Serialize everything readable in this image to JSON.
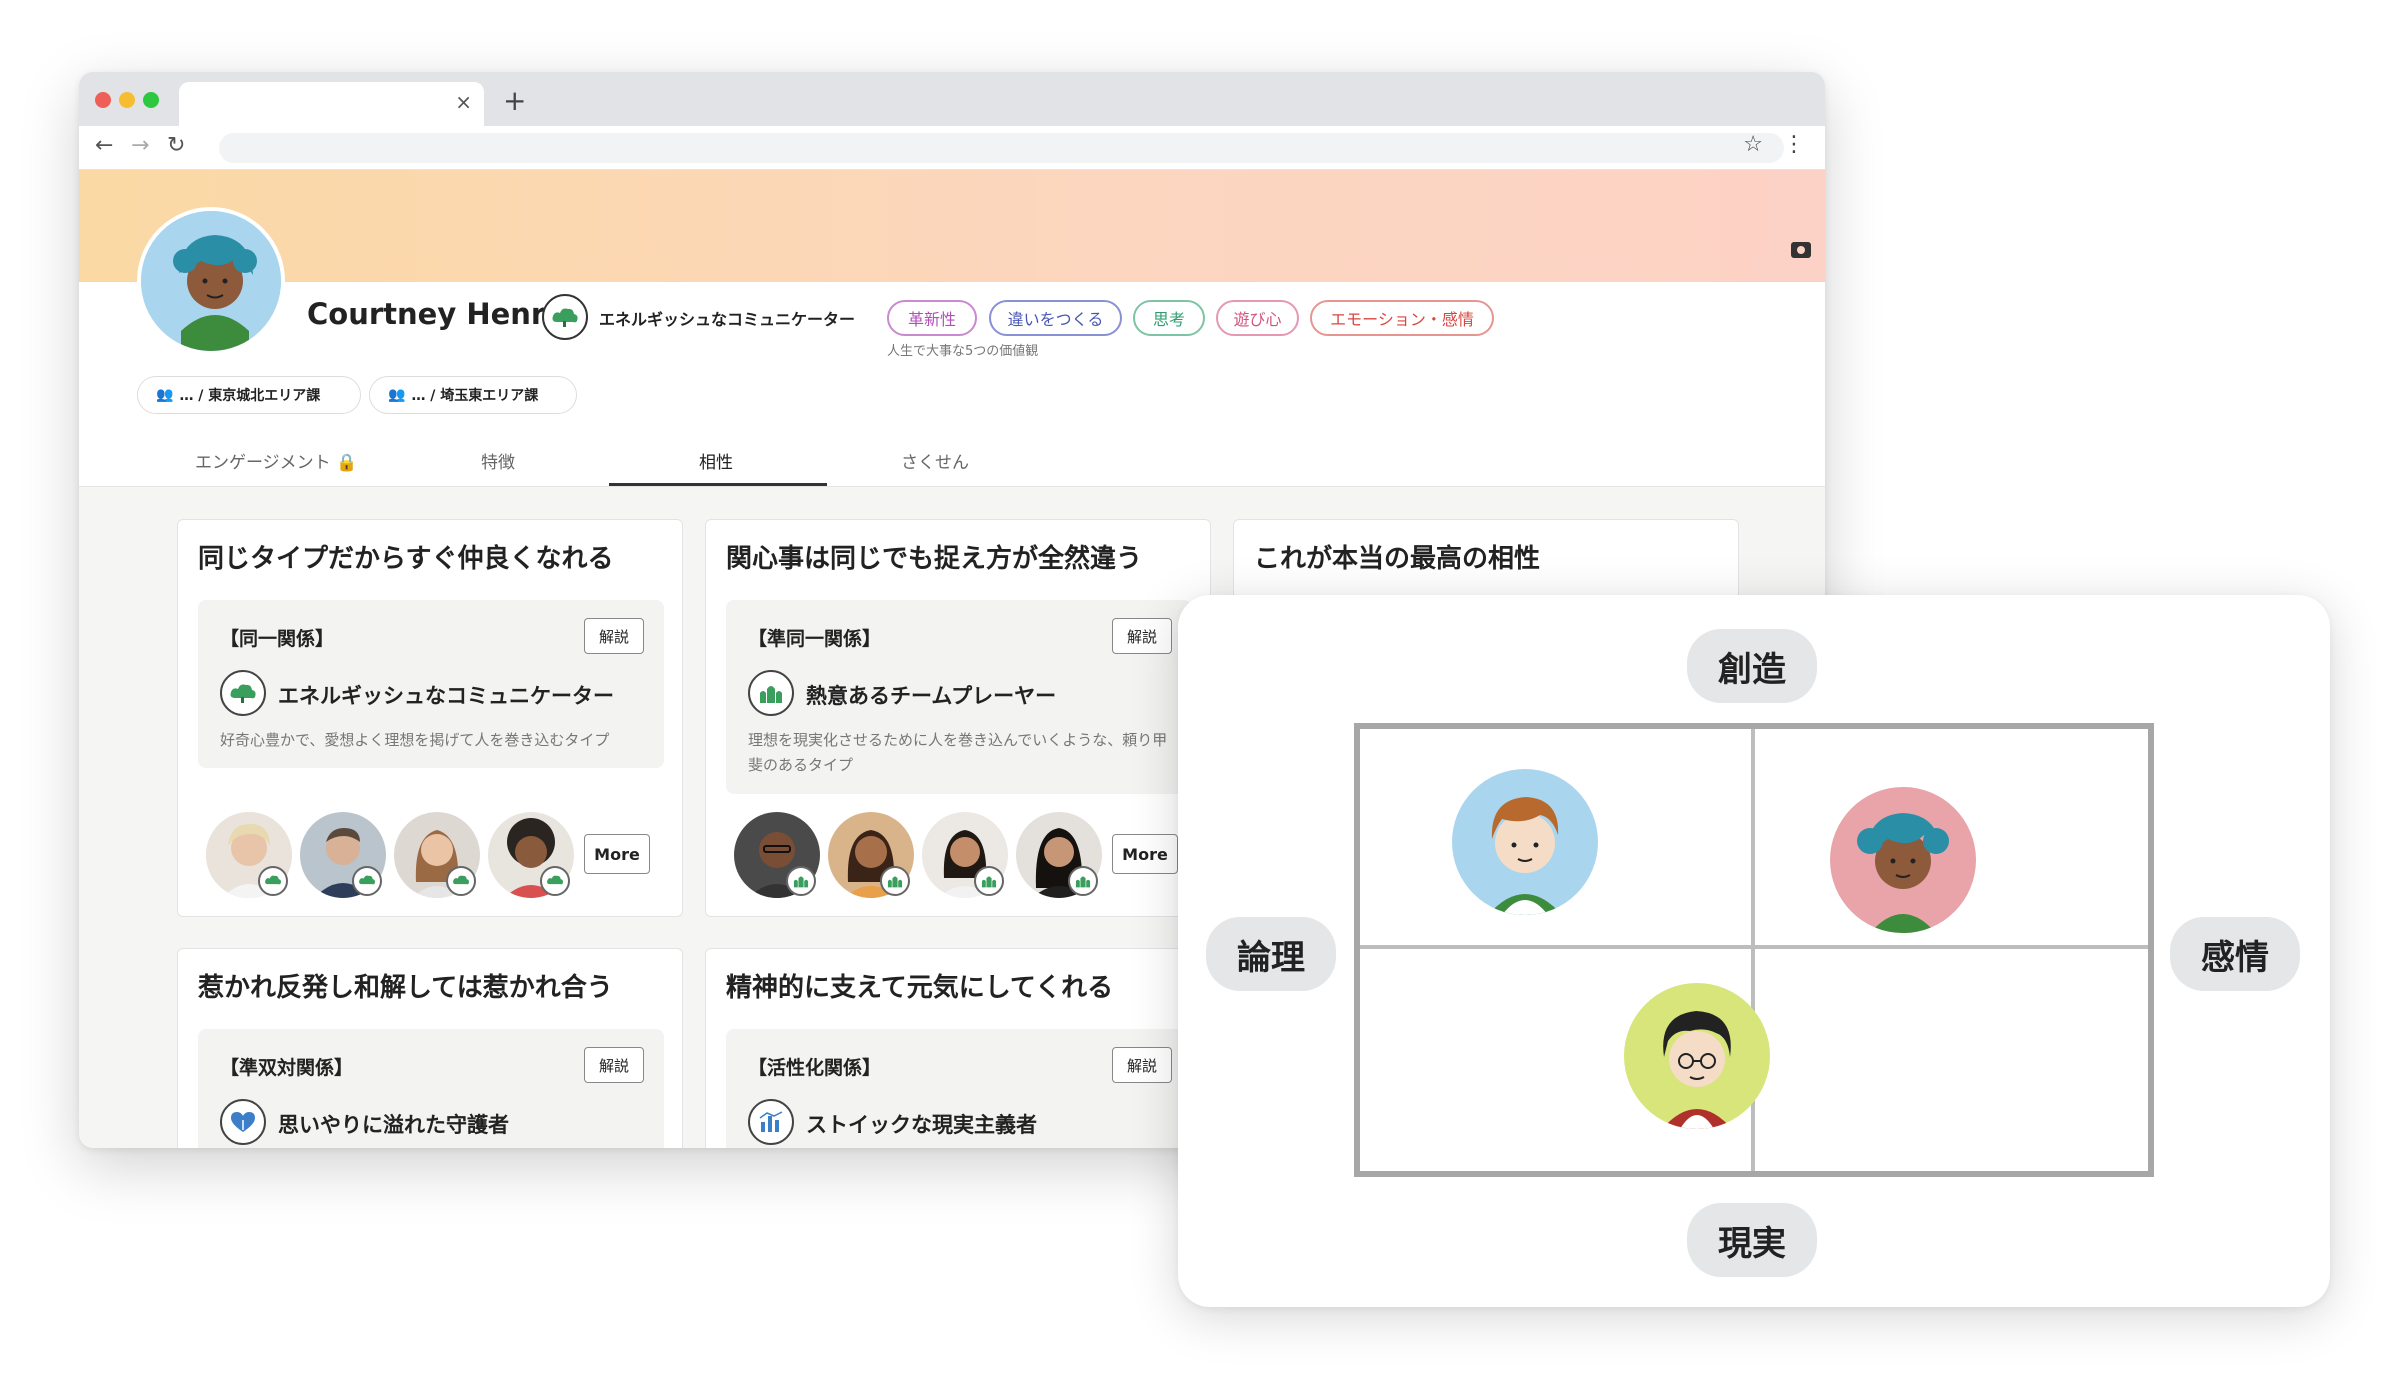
{
  "browser": {
    "tab_close": "×",
    "new_tab": "+",
    "back": "←",
    "forward": "→",
    "reload": "↻",
    "star": "☆",
    "menu": "⋮"
  },
  "profile": {
    "name": "Courtney Henry",
    "type_name": "エネルギッシュなコミュニケーター",
    "values": [
      {
        "label": "革新性",
        "color": "#b34fb8"
      },
      {
        "label": "違いをつくる",
        "color": "#4a56b6"
      },
      {
        "label": "思考",
        "color": "#2f9c6e"
      },
      {
        "label": "遊び心",
        "color": "#d2527f"
      },
      {
        "label": "エモーション・感情",
        "color": "#d9463f"
      }
    ],
    "values_caption": "人生で大事な5つの価値観",
    "teams": [
      {
        "label": "… / 東京城北エリア課"
      },
      {
        "label": "… / 埼玉東エリア課"
      }
    ]
  },
  "tabs": [
    {
      "label": "エンゲージメント 🔒"
    },
    {
      "label": "特徴"
    },
    {
      "label": "相性"
    },
    {
      "label": "さくせん"
    }
  ],
  "cards": [
    {
      "title": "同じタイプだからすぐ仲良くなれる",
      "relation": "【同一関係】",
      "explain": "解説",
      "type_name": "エネルギッシュなコミュニケーター",
      "description": "好奇心豊かで、愛想よく理想を掲げて人を巻き込むタイプ",
      "more": "More"
    },
    {
      "title": "関心事は同じでも捉え方が全然違う",
      "relation": "【準同一関係】",
      "explain": "解説",
      "type_name": "熱意あるチームプレーヤー",
      "description": "理想を現実化させるために人を巻き込んでいくような、頼り甲斐のあるタイプ",
      "more": "More"
    },
    {
      "title": "これが本当の最高の相性"
    },
    {
      "title": "惹かれ反発し和解しては惹かれ合う",
      "relation": "【準双対関係】",
      "explain": "解説",
      "type_name": "思いやりに溢れた守護者"
    },
    {
      "title": "精神的に支えて元気にしてくれる",
      "relation": "【活性化関係】",
      "explain": "解説",
      "type_name": "ストイックな現実主義者"
    }
  ],
  "matrix": {
    "top": "創造",
    "bottom": "現実",
    "left": "論理",
    "right": "感情"
  },
  "colors": {
    "banner_start": "#fbd9a4",
    "banner_end": "#fdd2c6",
    "type_green": "#2e8b57"
  }
}
